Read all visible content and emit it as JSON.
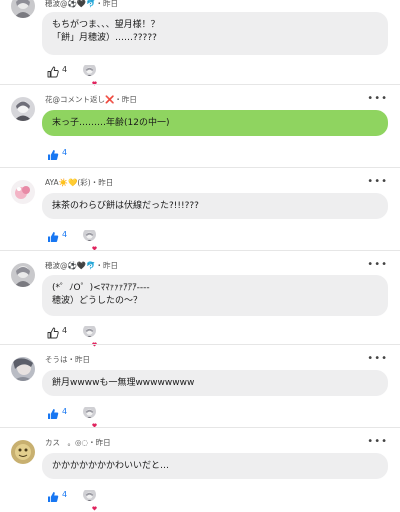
{
  "comments": [
    {
      "author": "穂波@⚽🖤🐬",
      "time": "昨日",
      "text": "もちがつま、、、望月様！？\n「餅」月穂波）……?????",
      "likes": "4",
      "liked": false,
      "highlight": false
    },
    {
      "author": "花@コメント返し❌",
      "time": "昨日",
      "text": "末っ子………年齢(12の中一)",
      "likes": "4",
      "liked": true,
      "highlight": true
    },
    {
      "author": "AYA☀️💛(彩)",
      "time": "昨日",
      "text": "抹茶のわらび餅は伏線だった?!!!???",
      "likes": "4",
      "liked": true,
      "highlight": false
    },
    {
      "author": "穂波@⚽🖤🐬",
      "time": "昨日",
      "text": "(*゜ﾉO゜)<ﾏﾏｧｧｧｱｱｱ----\n穂波）どうしたの〜？",
      "likes": "4",
      "liked": false,
      "highlight": false
    },
    {
      "author": "そうは",
      "time": "昨日",
      "text": "餅月wwwwも一無理wwwwwwww",
      "likes": "4",
      "liked": true,
      "highlight": false
    },
    {
      "author": "カス　。◎◌",
      "time": "昨日",
      "text": "かかかかかかかわいいだと…",
      "likes": "4",
      "liked": true,
      "highlight": false
    }
  ],
  "meta_separator": "・",
  "more_label": "•••",
  "colors": {
    "like_active": "#1877f2",
    "bubble": "#eeeeef",
    "bubble_highlight": "#8fd460"
  }
}
